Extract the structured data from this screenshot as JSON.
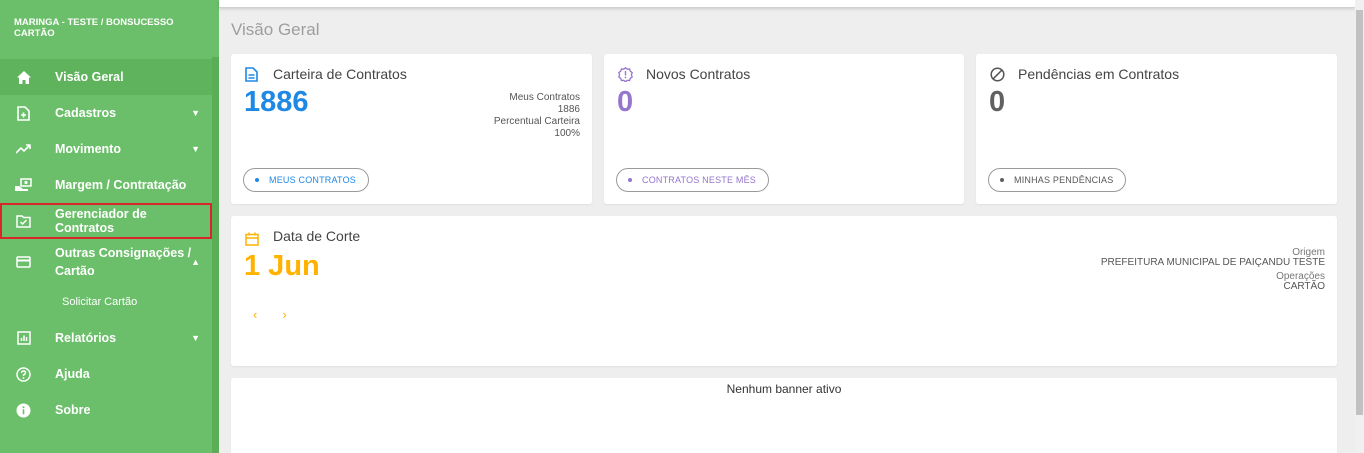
{
  "sidebar": {
    "org": "MARINGA - TESTE / BONSUCESSO CARTÃO",
    "items": [
      {
        "label": "Visão Geral"
      },
      {
        "label": "Cadastros"
      },
      {
        "label": "Movimento"
      },
      {
        "label": "Margem / Contratação"
      },
      {
        "label": "Gerenciador de Contratos"
      },
      {
        "label": "Outras Consignações / Cartão"
      },
      {
        "label": "Relatórios"
      },
      {
        "label": "Ajuda"
      },
      {
        "label": "Sobre"
      }
    ],
    "submenu": {
      "label": "Solicitar Cartão"
    }
  },
  "page": {
    "title": "Visão Geral"
  },
  "cards": {
    "carteira": {
      "title": "Carteira de Contratos",
      "value": "1886",
      "info": [
        "Meus Contratos",
        "1886",
        "Percentual Carteira",
        "100%"
      ],
      "button": "MEUS CONTRATOS",
      "color": "#1e88e5"
    },
    "novos": {
      "title": "Novos Contratos",
      "value": "0",
      "button": "CONTRATOS NESTE MÊS",
      "color": "#9575cd"
    },
    "pendencias": {
      "title": "Pendências em Contratos",
      "value": "0",
      "button": "MINHAS PENDÊNCIAS",
      "color": "#616161"
    },
    "corte": {
      "title": "Data de Corte",
      "value": "1 Jun",
      "info": [
        "Origem",
        "PREFEITURA MUNICIPAL DE PAIÇANDU TESTE",
        "Operações",
        "CARTÃO"
      ],
      "prev": "‹",
      "next": "›",
      "color": "#ffb300"
    }
  },
  "banner": {
    "text": "Nenhum banner ativo"
  }
}
